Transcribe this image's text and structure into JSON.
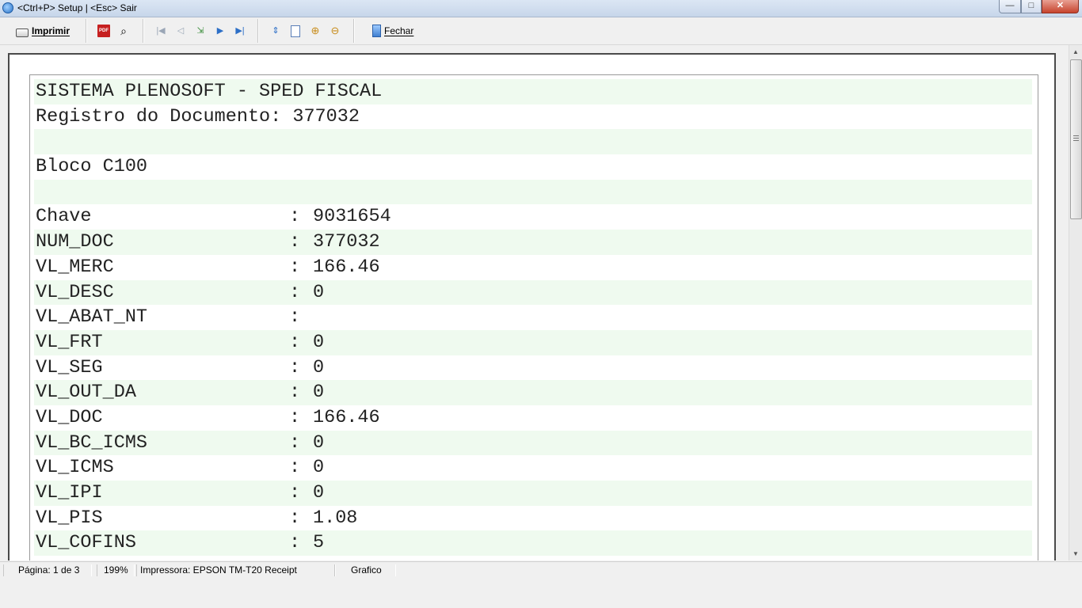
{
  "window": {
    "title": "<Ctrl+P> Setup | <Esc> Sair",
    "min_glyph": "—",
    "max_glyph": "□",
    "close_glyph": "✕"
  },
  "toolbar": {
    "print_label": "Imprimir",
    "close_label": "Fechar",
    "icons": [
      "printer-icon",
      "pdf-icon",
      "binoculars-icon",
      "first-page-icon",
      "prev-page-icon",
      "export-icon",
      "next-page-icon",
      "last-page-icon",
      "page-width-icon",
      "whole-page-icon",
      "zoom-in-icon",
      "zoom-out-icon",
      "exit-door-icon"
    ]
  },
  "report": {
    "header_title": "SISTEMA PLENOSOFT - SPED FISCAL",
    "doc_label": "Registro do Documento: 377032",
    "block_label": "Bloco C100",
    "fields": [
      {
        "name": "Chave",
        "value": "9031654"
      },
      {
        "name": "NUM_DOC",
        "value": "377032"
      },
      {
        "name": "VL_MERC",
        "value": "166.46"
      },
      {
        "name": "VL_DESC",
        "value": "0"
      },
      {
        "name": "VL_ABAT_NT",
        "value": ""
      },
      {
        "name": "VL_FRT",
        "value": "0"
      },
      {
        "name": "VL_SEG",
        "value": "0"
      },
      {
        "name": "VL_OUT_DA",
        "value": "0"
      },
      {
        "name": "VL_DOC",
        "value": "166.46"
      },
      {
        "name": "VL_BC_ICMS",
        "value": "0"
      },
      {
        "name": "VL_ICMS",
        "value": "0"
      },
      {
        "name": "VL_IPI",
        "value": "0"
      },
      {
        "name": "VL_PIS",
        "value": "1.08"
      },
      {
        "name": "VL_COFINS",
        "value": "5"
      }
    ],
    "colon": ":"
  },
  "status": {
    "page": "Página: 1 de 3",
    "zoom": "199%",
    "printer": "Impressora: EPSON TM-T20 Receipt",
    "mode": "Grafico"
  }
}
